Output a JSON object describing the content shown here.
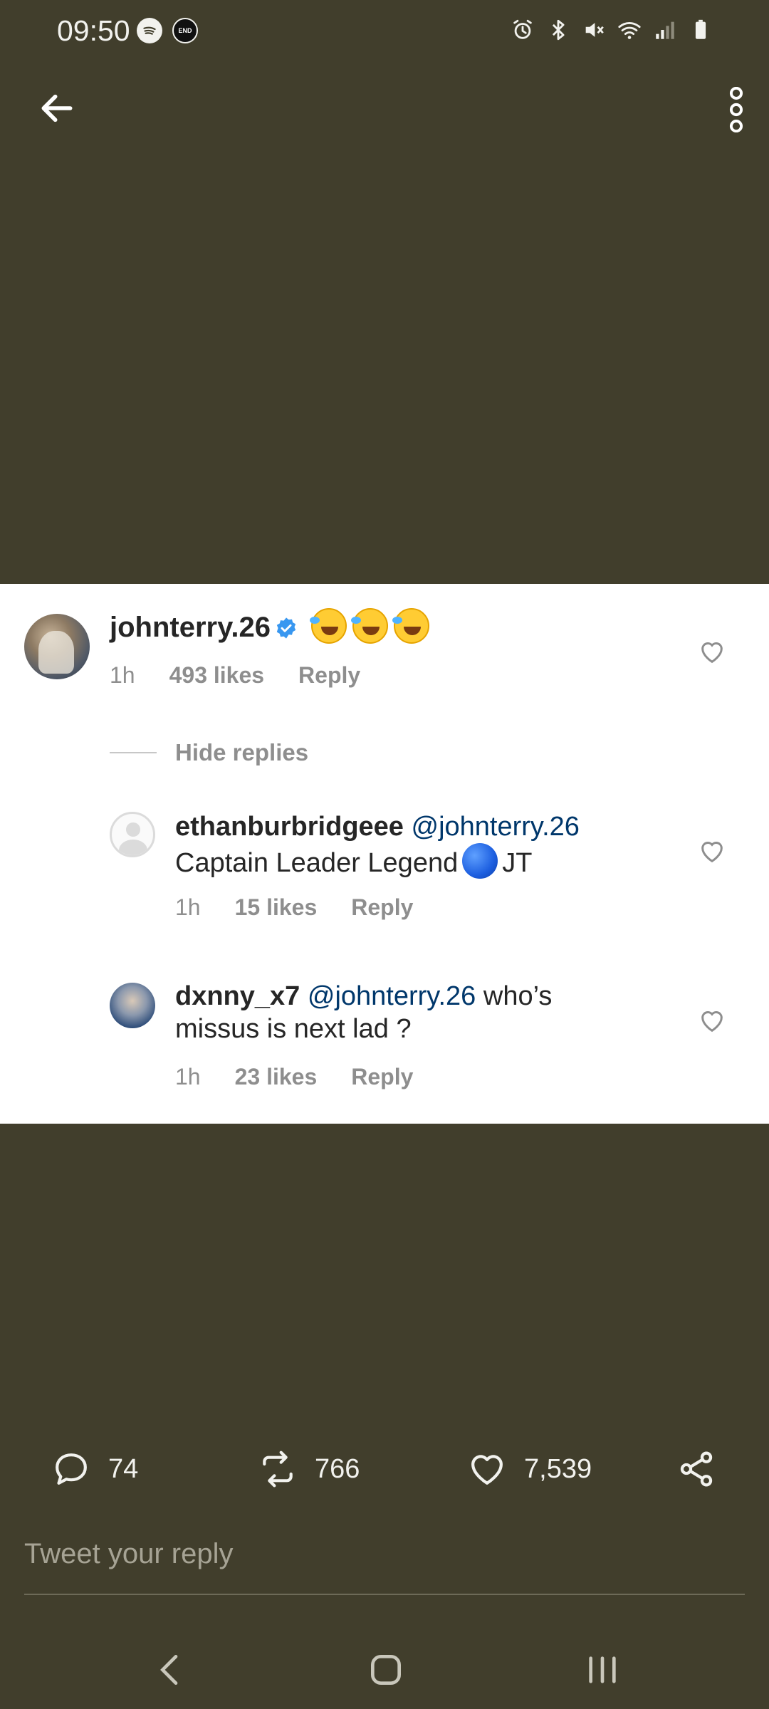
{
  "status_bar": {
    "time": "09:50",
    "end_badge": "END"
  },
  "colors": {
    "background": "#413e2c",
    "card": "#ffffff",
    "mention": "#00376b",
    "meta": "#8e8e8e"
  },
  "comment": {
    "username": "johnterry.26",
    "time": "1h",
    "likes": "493 likes",
    "reply": "Reply",
    "hide_replies": "Hide replies"
  },
  "replies": [
    {
      "username": "ethanburbridgeee",
      "mention": "@johnterry.26",
      "text_before": "Captain Leader Legend",
      "text_after": "JT",
      "time": "1h",
      "likes": "15 likes",
      "reply": "Reply"
    },
    {
      "username": "dxnny_x7",
      "mention": "@johnterry.26",
      "text_line1": "who’s",
      "text_line2": "missus is next lad ?",
      "time": "1h",
      "likes": "23 likes",
      "reply": "Reply"
    }
  ],
  "actions": {
    "comments": "74",
    "retweets": "766",
    "likes": "7,539"
  },
  "reply_box": {
    "placeholder": "Tweet your reply"
  }
}
